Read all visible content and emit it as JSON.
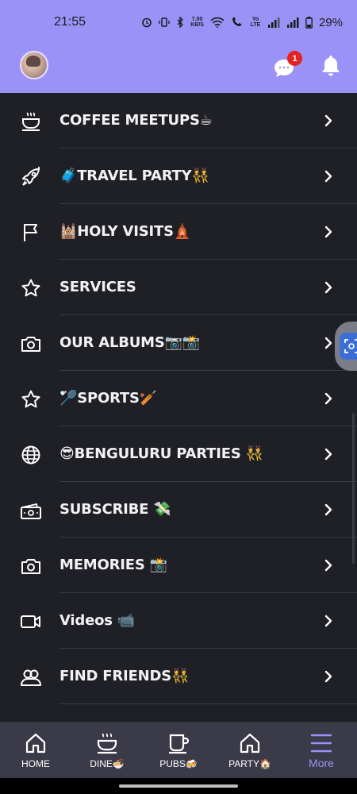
{
  "status_bar": {
    "time": "21:55",
    "network_speed_value": "7.00",
    "network_speed_unit": "KB/S",
    "volte_label": "Yo LTE",
    "battery_percent": "29%"
  },
  "header": {
    "chat_badge_count": "1"
  },
  "menu": {
    "items": [
      {
        "label": "COFFEE MEETUPS☕",
        "icon": "coffee-cup-icon"
      },
      {
        "label": "🧳TRAVEL PARTY👯",
        "icon": "rocket-icon"
      },
      {
        "label": "🕍HOLY VISITS🛕",
        "icon": "flag-icon"
      },
      {
        "label": "SERVICES",
        "icon": "star-icon"
      },
      {
        "label": "OUR ALBUMS📷📸",
        "icon": "camera-icon"
      },
      {
        "label": "🏸SPORTS🏏",
        "icon": "star-icon"
      },
      {
        "label": "😎BENGULURU PARTIES 👯",
        "icon": "globe-icon"
      },
      {
        "label": "SUBSCRIBE 💸",
        "icon": "money-icon"
      },
      {
        "label": "MEMORIES 📸",
        "icon": "camera-icon"
      },
      {
        "label": "Videos 📹",
        "icon": "video-camera-icon"
      },
      {
        "label": "FIND FRIENDS👯",
        "icon": "friends-icon"
      }
    ]
  },
  "tabbar": {
    "tabs": [
      {
        "label": "HOME",
        "icon": "home-icon",
        "active": false
      },
      {
        "label": "DINE🍜",
        "icon": "steaming-bowl-icon",
        "active": false
      },
      {
        "label": "PUBS🍻",
        "icon": "mug-icon",
        "active": false
      },
      {
        "label": "PARTY🏠",
        "icon": "home-outline-icon",
        "active": false
      },
      {
        "label": "More",
        "icon": "hamburger-menu-icon",
        "active": true
      }
    ]
  },
  "colors": {
    "accent": "#9b92f7",
    "background": "#1f1f26",
    "tabbar": "#3a3a48",
    "badge": "#e52222",
    "text": "#f2f2f4"
  }
}
